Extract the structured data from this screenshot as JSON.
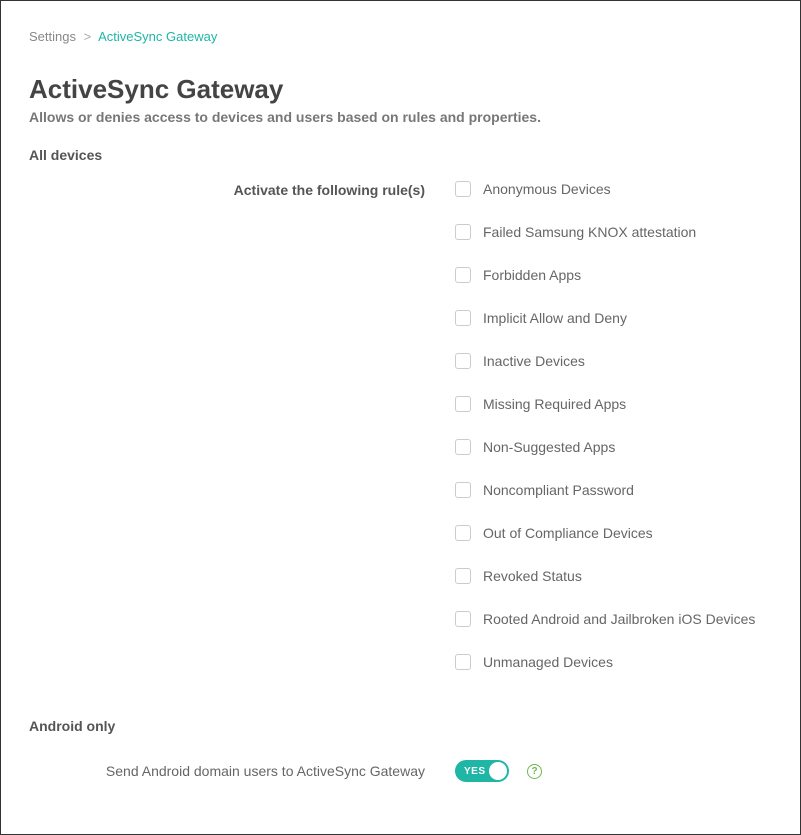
{
  "breadcrumb": {
    "parent": "Settings",
    "separator": ">",
    "current": "ActiveSync Gateway"
  },
  "page": {
    "title": "ActiveSync Gateway",
    "subtitle": "Allows or denies access to devices and users based on rules and properties."
  },
  "section_all_devices": {
    "title": "All devices",
    "rules_label": "Activate the following rule(s)"
  },
  "rules": [
    {
      "label": "Anonymous Devices",
      "checked": false
    },
    {
      "label": "Failed Samsung KNOX attestation",
      "checked": false
    },
    {
      "label": "Forbidden Apps",
      "checked": false
    },
    {
      "label": "Implicit Allow and Deny",
      "checked": false
    },
    {
      "label": "Inactive Devices",
      "checked": false
    },
    {
      "label": "Missing Required Apps",
      "checked": false
    },
    {
      "label": "Non-Suggested Apps",
      "checked": false
    },
    {
      "label": "Noncompliant Password",
      "checked": false
    },
    {
      "label": "Out of Compliance Devices",
      "checked": false
    },
    {
      "label": "Revoked Status",
      "checked": false
    },
    {
      "label": "Rooted Android and Jailbroken iOS Devices",
      "checked": false
    },
    {
      "label": "Unmanaged Devices",
      "checked": false
    }
  ],
  "section_android": {
    "title": "Android only",
    "send_label": "Send Android domain users to ActiveSync Gateway",
    "toggle_value": "YES",
    "toggle_on": true
  }
}
